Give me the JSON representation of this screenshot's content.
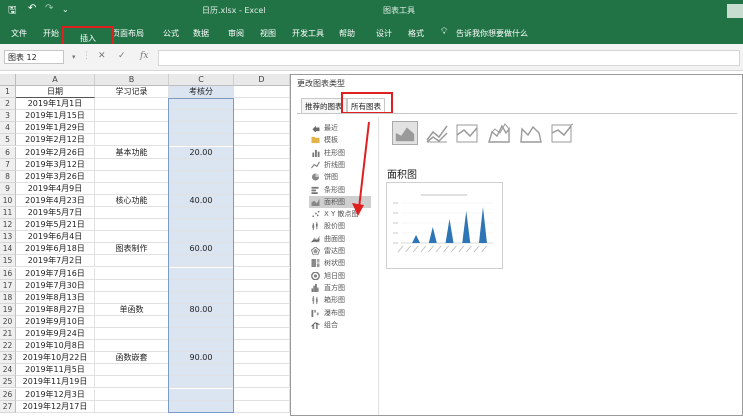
{
  "app": {
    "quick_access": {
      "save": "🖫",
      "undo": "↶",
      "redo": "↷",
      "more": "⌄"
    },
    "file_title": "日历.xlsx - Excel",
    "context_title": "图表工具"
  },
  "ribbon": {
    "tabs": [
      "文件",
      "开始",
      "插入",
      "页面布局",
      "公式",
      "数据",
      "审阅",
      "视图",
      "开发工具",
      "帮助",
      "设计",
      "格式"
    ],
    "tell_me": "告诉我你想要做什么"
  },
  "formula_bar": {
    "name_box": "图表 12",
    "cancel": "✕",
    "enter": "✓",
    "fx": "fx",
    "content": ""
  },
  "sheet": {
    "columns": [
      "A",
      "B",
      "C",
      "D"
    ],
    "rows": [
      {
        "n": "1",
        "a": "日期",
        "b": "学习记录",
        "c": "考核分"
      },
      {
        "n": "2",
        "a": "2019年1月1日",
        "b": "",
        "c": ""
      },
      {
        "n": "3",
        "a": "2019年1月15日",
        "b": "",
        "c": ""
      },
      {
        "n": "4",
        "a": "2019年1月29日",
        "b": "",
        "c": ""
      },
      {
        "n": "5",
        "a": "2019年2月12日",
        "b": "",
        "c": ""
      },
      {
        "n": "6",
        "a": "2019年2月26日",
        "b": "基本功能",
        "c": "20.00"
      },
      {
        "n": "7",
        "a": "2019年3月12日",
        "b": "",
        "c": ""
      },
      {
        "n": "8",
        "a": "2019年3月26日",
        "b": "",
        "c": ""
      },
      {
        "n": "9",
        "a": "2019年4月9日",
        "b": "",
        "c": ""
      },
      {
        "n": "10",
        "a": "2019年4月23日",
        "b": "核心功能",
        "c": "40.00"
      },
      {
        "n": "11",
        "a": "2019年5月7日",
        "b": "",
        "c": ""
      },
      {
        "n": "12",
        "a": "2019年5月21日",
        "b": "",
        "c": ""
      },
      {
        "n": "13",
        "a": "2019年6月4日",
        "b": "",
        "c": ""
      },
      {
        "n": "14",
        "a": "2019年6月18日",
        "b": "图表制作",
        "c": "60.00"
      },
      {
        "n": "15",
        "a": "2019年7月2日",
        "b": "",
        "c": ""
      },
      {
        "n": "16",
        "a": "2019年7月16日",
        "b": "",
        "c": ""
      },
      {
        "n": "17",
        "a": "2019年7月30日",
        "b": "",
        "c": ""
      },
      {
        "n": "18",
        "a": "2019年8月13日",
        "b": "",
        "c": ""
      },
      {
        "n": "19",
        "a": "2019年8月27日",
        "b": "单函数",
        "c": "80.00"
      },
      {
        "n": "20",
        "a": "2019年9月10日",
        "b": "",
        "c": ""
      },
      {
        "n": "21",
        "a": "2019年9月24日",
        "b": "",
        "c": ""
      },
      {
        "n": "22",
        "a": "2019年10月8日",
        "b": "",
        "c": ""
      },
      {
        "n": "23",
        "a": "2019年10月22日",
        "b": "函数嵌套",
        "c": "90.00"
      },
      {
        "n": "24",
        "a": "2019年11月5日",
        "b": "",
        "c": ""
      },
      {
        "n": "25",
        "a": "2019年11月19日",
        "b": "",
        "c": ""
      },
      {
        "n": "26",
        "a": "2019年12月3日",
        "b": "",
        "c": ""
      },
      {
        "n": "27",
        "a": "2019年12月17日",
        "b": "",
        "c": ""
      }
    ]
  },
  "dialog": {
    "title": "更改图表类型",
    "tabs": [
      "推荐的图表",
      "所有图表"
    ],
    "categories": [
      {
        "label": "最近",
        "icon": "recent-icon"
      },
      {
        "label": "模板",
        "icon": "template-folder-icon"
      },
      {
        "label": "柱形图",
        "icon": "column-chart-icon"
      },
      {
        "label": "折线图",
        "icon": "line-chart-icon"
      },
      {
        "label": "饼图",
        "icon": "pie-chart-icon"
      },
      {
        "label": "条形图",
        "icon": "bar-chart-icon"
      },
      {
        "label": "面积图",
        "icon": "area-chart-icon"
      },
      {
        "label": "X Y 散点图",
        "icon": "scatter-chart-icon"
      },
      {
        "label": "股价图",
        "icon": "stock-chart-icon"
      },
      {
        "label": "曲面图",
        "icon": "surface-chart-icon"
      },
      {
        "label": "雷达图",
        "icon": "radar-chart-icon"
      },
      {
        "label": "树状图",
        "icon": "treemap-chart-icon"
      },
      {
        "label": "旭日图",
        "icon": "sunburst-chart-icon"
      },
      {
        "label": "直方图",
        "icon": "histogram-chart-icon"
      },
      {
        "label": "箱形图",
        "icon": "box-whisker-chart-icon"
      },
      {
        "label": "瀑布图",
        "icon": "waterfall-chart-icon"
      },
      {
        "label": "组合",
        "icon": "combo-chart-icon"
      }
    ],
    "selected_category": "面积图",
    "subtype_title": "面积图",
    "preview_values": [
      20,
      40,
      60,
      80,
      90
    ],
    "colors": {
      "accent": "#2e75b6",
      "excel_green": "#217346",
      "highlight_red": "#e02020"
    }
  }
}
